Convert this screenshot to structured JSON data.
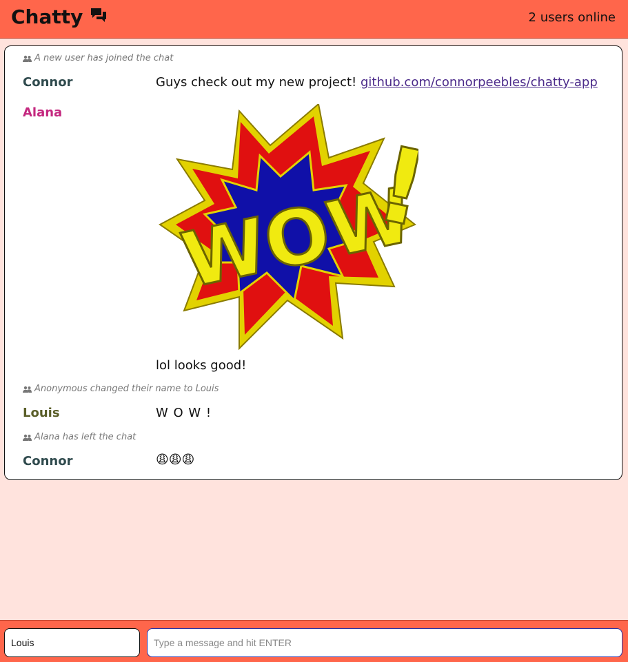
{
  "app": {
    "title": "Chatty",
    "users_online": "2 users online",
    "colors": {
      "navbar": "#ff664b",
      "background": "#ffe3dd"
    }
  },
  "messages": [
    {
      "type": "notification",
      "text": "A new user has joined the chat"
    },
    {
      "type": "message",
      "username": "Connor",
      "user_color": "#2f4a4d",
      "text": "Guys check out my new project! ",
      "link": "github.com/connorpeebles/chatty-app"
    },
    {
      "type": "message",
      "username": "Alana",
      "user_color": "#c4287f",
      "image": "WOW!",
      "text": "lol looks good!"
    },
    {
      "type": "notification",
      "text": "Anonymous changed their name to Louis"
    },
    {
      "type": "message",
      "username": "Louis",
      "user_color": "#5a5e28",
      "text": "W O W !"
    },
    {
      "type": "notification",
      "text": "Alana has left the chat"
    },
    {
      "type": "message",
      "username": "Connor",
      "user_color": "#2f4a4d",
      "text": "😩😩😩"
    }
  ],
  "composer": {
    "username_value": "Louis",
    "message_placeholder": "Type a message and hit ENTER"
  }
}
